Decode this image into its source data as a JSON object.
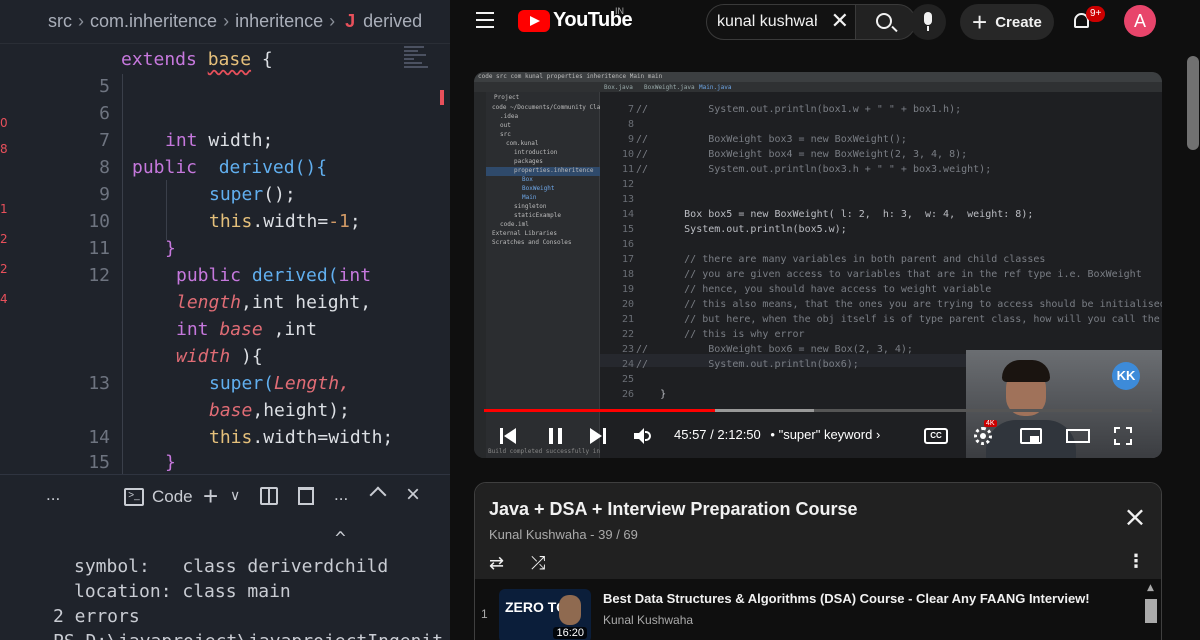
{
  "vscode": {
    "breadcrumb": [
      "src",
      "com.inheritence",
      "inheritence",
      "derived"
    ],
    "breadcrumb_last_icon": "J",
    "lines": [
      {
        "no": "",
        "code_a": "extends",
        "code_b": "base",
        "code_c": "{"
      },
      {
        "no": "5"
      },
      {
        "no": "6"
      },
      {
        "no": "7",
        "t1": "int",
        "t2": "width;"
      },
      {
        "no": "8",
        "t1": "public",
        "t2": "derived(){"
      },
      {
        "no": "9",
        "t1": "super",
        "t2": "();"
      },
      {
        "no": "10",
        "t1": "this",
        "t2": ".width=",
        "t3": "-1",
        "t4": ";"
      },
      {
        "no": "11",
        "t1": "}"
      },
      {
        "no": "12",
        "t1": "public",
        "t2": "derived(",
        "t3": "int"
      },
      {
        "no": "",
        "t1": "length",
        "t2": ",int",
        "t3": "height,"
      },
      {
        "no": "",
        "t1": "int",
        "t2": "base",
        "t3": ",int"
      },
      {
        "no": "",
        "t1": "width",
        "t2": "){"
      },
      {
        "no": "13",
        "t1": "super(",
        "t2": "Length,"
      },
      {
        "no": "",
        "t1": "base",
        "t2": ",height);"
      },
      {
        "no": "14",
        "t1": "this",
        "t2": ".width=width;"
      },
      {
        "no": "15",
        "t1": "}"
      }
    ],
    "left_gutter_marks": [
      "0",
      "8",
      "1",
      "2",
      "2",
      "4"
    ],
    "panel": {
      "more": "...",
      "tab_label": "Code",
      "plus": "+",
      "chevron": "∨",
      "more2": "..."
    },
    "terminal": {
      "caret": "^",
      "line1": "symbol:   class deriverdchild",
      "line2": "location: class main",
      "line3": "2 errors",
      "line4": "PS D:\\javaproject\\javaprojectIngenit"
    }
  },
  "youtube": {
    "logo_text": "YouTube",
    "country_code": "IN",
    "search_value": "kunal kushwaha",
    "create_label": "Create",
    "notif_count": "9+",
    "avatar_letter": "A",
    "player": {
      "current_time": "45:57",
      "duration": "2:12:50",
      "chapter": "\"super\" keyword",
      "time_separator": " / ",
      "chapter_prefix": "•",
      "quality_badge": "4K",
      "progress_fraction": 0.346,
      "buffer_fraction": 0.494,
      "cc_label": "CC",
      "channel_badge": "KK",
      "ide": {
        "top_bar": "code  src  com  kunal  properties  inheritence  Main  main",
        "tabs": [
          "Box.java",
          "BoxWeight.java",
          "Main.java"
        ],
        "project_label": "Project",
        "project_items": [
          "code  ~/Documents/Community Class",
          ".idea",
          "out",
          "src",
          "com.kunal",
          "introduction",
          "packages",
          "properties.inheritence",
          "Box",
          "BoxWeight",
          "Main",
          "singleton",
          "staticExample",
          "code.iml",
          "External Libraries",
          "Scratches and Consoles"
        ],
        "code_lines": [
          {
            "no": "7",
            "text": "//          System.out.println(box1.w + \" \" + box1.h);"
          },
          {
            "no": "8",
            "text": ""
          },
          {
            "no": "9",
            "text": "//          BoxWeight box3 = new BoxWeight();"
          },
          {
            "no": "10",
            "text": "//          BoxWeight box4 = new BoxWeight(2, 3, 4, 8);"
          },
          {
            "no": "11",
            "text": "//          System.out.println(box3.h + \" \" + box3.weight);"
          },
          {
            "no": "12",
            "text": ""
          },
          {
            "no": "13",
            "text": ""
          },
          {
            "no": "14",
            "text": "        Box box5 = new BoxWeight( l: 2,  h: 3,  w: 4,  weight: 8);"
          },
          {
            "no": "15",
            "text": "        System.out.println(box5.w);"
          },
          {
            "no": "16",
            "text": ""
          },
          {
            "no": "17",
            "text": "        // there are many variables in both parent and child classes"
          },
          {
            "no": "18",
            "text": "        // you are given access to variables that are in the ref type i.e. BoxWeight"
          },
          {
            "no": "19",
            "text": "        // hence, you should have access to weight variable"
          },
          {
            "no": "20",
            "text": "        // this also means, that the ones you are trying to access should be initialised"
          },
          {
            "no": "21",
            "text": "        // but here, when the obj itself is of type parent class, how will you call the"
          },
          {
            "no": "22",
            "text": "        // this is why error"
          },
          {
            "no": "23",
            "text": "//          BoxWeight box6 = new Box(2, 3, 4);"
          },
          {
            "no": "24",
            "text": "//          System.out.println(box6);"
          },
          {
            "no": "25",
            "text": ""
          },
          {
            "no": "26",
            "text": "    }"
          }
        ],
        "status_bar": "Build completed successfully in 2 sec, 356 ms (38 minutes ago)"
      }
    },
    "playlist": {
      "title": "Java + DSA + Interview Preparation Course",
      "subtitle": "Kunal Kushwaha - 39 / 69",
      "item": {
        "index": "1",
        "title": "Best Data Structures & Algorithms (DSA) Course - Clear Any FAANG Interview!",
        "channel": "Kunal Kushwaha",
        "duration": "16:20",
        "thumb_text": "ZERO TO"
      }
    }
  }
}
